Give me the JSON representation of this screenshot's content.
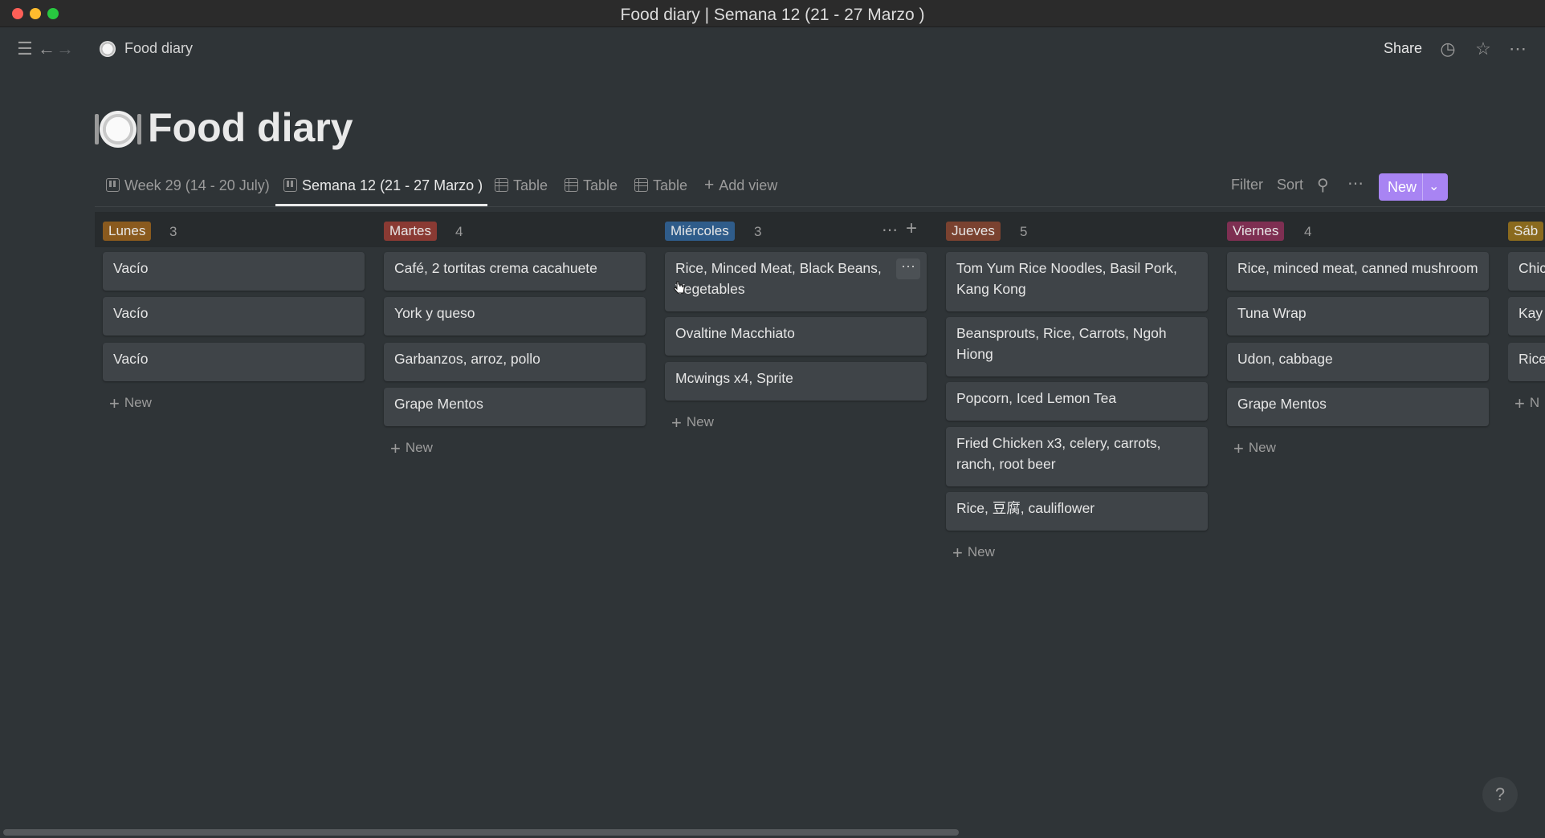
{
  "window": {
    "title": "Food diary | Semana 12 (21 - 27 Marzo )"
  },
  "topbar": {
    "breadcrumb": "Food diary",
    "share_label": "Share"
  },
  "page": {
    "title": "Food diary"
  },
  "tabs": [
    {
      "label": "Week 29 (14 - 20 July)",
      "icon": "board-icon"
    },
    {
      "label": "Semana 12 (21 - 27 Marzo )",
      "icon": "board-icon",
      "active": true
    },
    {
      "label": "Table",
      "icon": "table-icon"
    },
    {
      "label": "Table",
      "icon": "table-icon"
    },
    {
      "label": "Table",
      "icon": "table-icon"
    }
  ],
  "add_view_label": "Add view",
  "toolbar": {
    "filter": "Filter",
    "sort": "Sort",
    "new": "New"
  },
  "board": {
    "add_label": "New",
    "columns": [
      {
        "name": "Lunes",
        "color": "#8a5a1e",
        "count": "3",
        "cards": [
          "Vacío",
          "Vacío",
          "Vacío"
        ]
      },
      {
        "name": "Martes",
        "color": "#8a3a33",
        "count": "4",
        "cards": [
          "Café, 2 tortitas crema cacahuete",
          "York y queso",
          "Garbanzos, arroz, pollo",
          "Grape Mentos"
        ]
      },
      {
        "name": "Miércoles",
        "color": "#2f5c8a",
        "count": "3",
        "cards": [
          "Rice, Minced Meat, Black Beans, Vegetables",
          "Ovaltine Macchiato",
          "Mcwings x4, Sprite"
        ]
      },
      {
        "name": "Jueves",
        "color": "#7a4230",
        "count": "5",
        "cards": [
          "Tom Yum Rice Noodles, Basil Pork, Kang Kong",
          "Beansprouts, Rice, Carrots, Ngoh Hiong",
          "Popcorn, Iced Lemon Tea",
          "Fried Chicken x3, celery, carrots, ranch, root beer",
          "Rice, 豆腐, cauliflower"
        ]
      },
      {
        "name": "Viernes",
        "color": "#7e2f52",
        "count": "4",
        "cards": [
          "Rice, minced meat, canned mushroom",
          "Tuna Wrap",
          "Udon, cabbage",
          "Grape Mentos"
        ]
      },
      {
        "name": "Sáb",
        "color": "#8a6a1e",
        "count": "",
        "cards": [
          "Chic",
          "Kay",
          "Rice"
        ]
      }
    ]
  },
  "help_label": "?"
}
